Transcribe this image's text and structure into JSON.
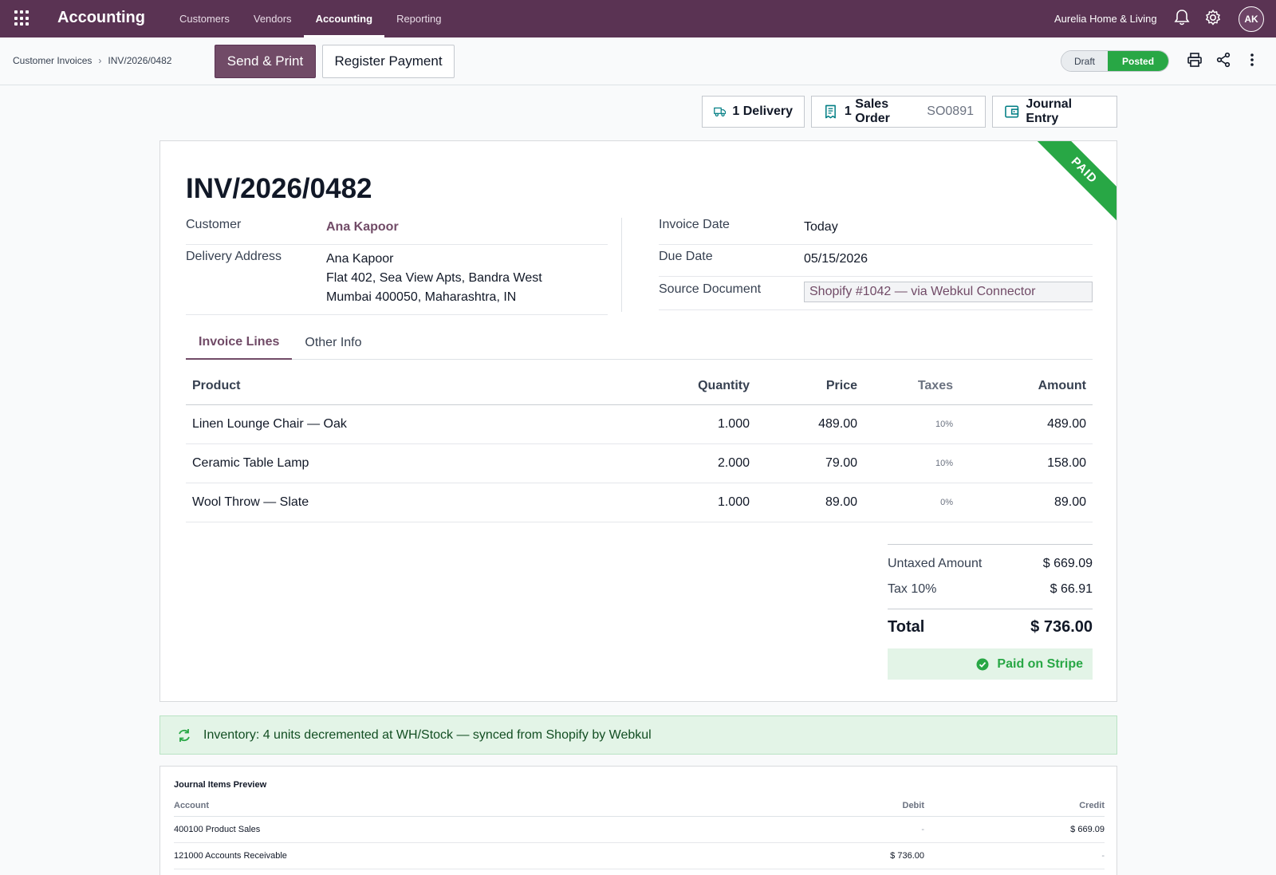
{
  "navbar": {
    "app_title": "Accounting",
    "menu": [
      "Customers",
      "Vendors",
      "Accounting",
      "Reporting"
    ],
    "active_menu": "Accounting",
    "company": "Aurelia Home & Living",
    "avatar_initials": "AK",
    "bg_color": "#5a3353"
  },
  "controlbar": {
    "breadcrumb_parent": "Customer Invoices",
    "breadcrumb_sep": ">",
    "breadcrumb_current": "INV/2026/0482",
    "send_print": "Send & Print",
    "register_payment": "Register Payment",
    "status_draft": "Draft",
    "status_posted": "Posted",
    "active_status": "Posted"
  },
  "smart_buttons": {
    "delivery_count": "1",
    "delivery_label": "Delivery",
    "sales_count": "1",
    "sales_label": "Sales Order",
    "sales_ref": "SO0891",
    "journal_label": "Journal Entry"
  },
  "invoice": {
    "ribbon": "PAID",
    "number": "INV/2026/0482",
    "customer_label": "Customer",
    "customer": "Ana Kapoor",
    "delivery_label": "Delivery Address",
    "address_line1": "Ana Kapoor",
    "address_line2": "Flat 402, Sea View Apts, Bandra West",
    "address_line3": "Mumbai 400050, Maharashtra, IN",
    "invoice_date_label": "Invoice Date",
    "invoice_date": "Today",
    "due_date_label": "Due Date",
    "due_date": "05/15/2026",
    "source_label": "Source Document",
    "source": "Shopify #1042 — via Webkul Connector"
  },
  "tabs": [
    "Invoice Lines",
    "Other Info"
  ],
  "lines": {
    "headers": {
      "product": "Product",
      "quantity": "Quantity",
      "price": "Price",
      "taxes": "Taxes",
      "amount": "Amount"
    },
    "rows": [
      {
        "product": "Linen Lounge Chair — Oak",
        "quantity": "1.000",
        "price": "489.00",
        "taxes": "10%",
        "amount": "489.00"
      },
      {
        "product": "Ceramic Table Lamp",
        "quantity": "2.000",
        "price": "79.00",
        "taxes": "10%",
        "amount": "158.00"
      },
      {
        "product": "Wool Throw — Slate",
        "quantity": "1.000",
        "price": "89.00",
        "taxes": "0%",
        "amount": "89.00"
      }
    ]
  },
  "totals": {
    "untaxed_label": "Untaxed Amount",
    "untaxed": "$ 669.09",
    "tax_label": "Tax 10%",
    "tax": "$ 66.91",
    "total_label": "Total",
    "total": "$ 736.00",
    "paid_label": "Paid on Stripe"
  },
  "banner": {
    "text": "Inventory: 4 units decremented at WH/Stock — synced from Shopify by Webkul"
  },
  "journal": {
    "title": "Journal Items Preview",
    "headers": {
      "account": "Account",
      "debit": "Debit",
      "credit": "Credit"
    },
    "rows": [
      {
        "account": "400100 Product Sales",
        "debit": "-",
        "credit": "$ 669.09"
      },
      {
        "account": "121000 Accounts Receivable",
        "debit": "$ 736.00",
        "credit": "-"
      }
    ]
  },
  "colors": {
    "brand": "#714b67",
    "success": "#28a745"
  }
}
